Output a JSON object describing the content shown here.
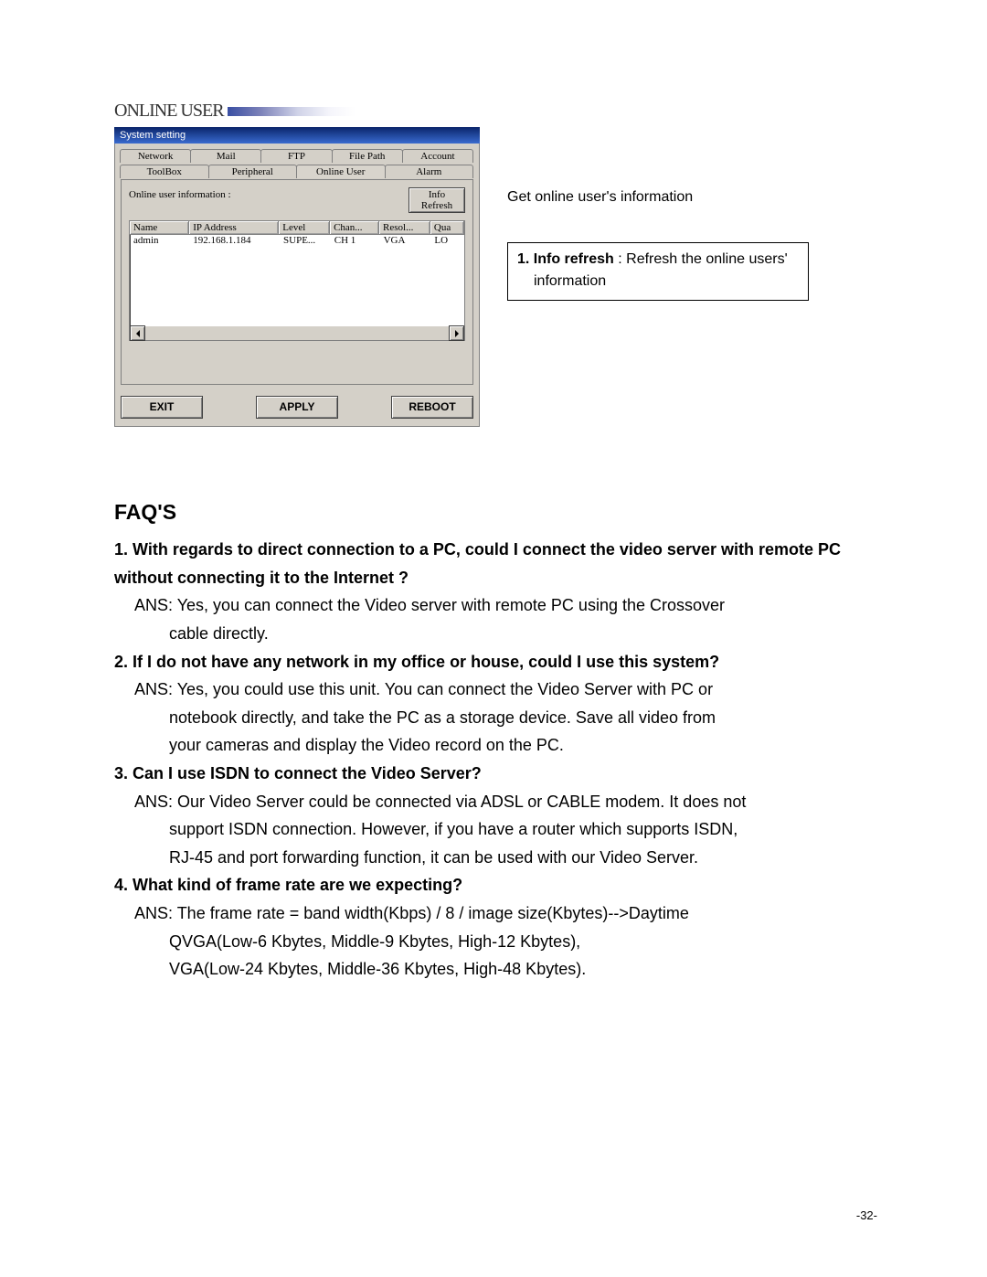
{
  "section_header": "ONLINE USER",
  "dialog": {
    "title": "System setting",
    "tabs_top": [
      "Network",
      "Mail",
      "FTP",
      "File Path",
      "Account"
    ],
    "tabs_bottom": [
      "ToolBox",
      "Peripheral",
      "Online User",
      "Alarm"
    ],
    "info_label": "Online user information :",
    "info_btn": "Info\nRefresh",
    "columns": [
      "Name",
      "IP Address",
      "Level",
      "Chan...",
      "Resol...",
      "Qua"
    ],
    "rows": [
      {
        "name": "admin",
        "ip": "192.168.1.184",
        "level": "SUPE...",
        "chan": "CH 1",
        "resol": "VGA",
        "qua": "LO"
      }
    ],
    "btn_exit": "EXIT",
    "btn_apply": "APPLY",
    "btn_reboot": "REBOOT"
  },
  "side": {
    "caption": "Get online user's information",
    "info_lead": "1. Info refresh",
    "info_sep": " : ",
    "info_rest": "Refresh the online users'",
    "info_line2": "information"
  },
  "faq": {
    "title": "FAQ'S",
    "q1": "1. With regards to direct connection to a PC, could I connect the video server with remote PC without connecting it to the Internet ?",
    "a1a": "ANS: Yes, you can connect  the Video server with remote PC using the Crossover",
    "a1b": "cable directly.",
    "q2": "2. If I do not have any network in my office or house, could I use this system?",
    "a2a": "ANS: Yes, you could use this unit. You can connect the Video Server with PC or",
    "a2b": "notebook directly, and take the PC as a storage device. Save all video from",
    "a2c": "your cameras and display the Video record on the PC.",
    "q3": "3. Can I use ISDN to connect the Video Server?",
    "a3a": "ANS: Our Video Server could be connected via ADSL or CABLE modem. It does not",
    "a3b": "support ISDN connection. However, if you have a router which supports ISDN,",
    "a3c": "RJ-45 and port forwarding function, it can be used with our Video Server.",
    "q4": "4. What kind of frame rate are we expecting?",
    "a4a": "ANS: The frame rate = band width(Kbps) / 8 / image size(Kbytes)-->Daytime",
    "a4b": "QVGA(Low-6 Kbytes, Middle-9 Kbytes, High-12 Kbytes),",
    "a4c": " VGA(Low-24 Kbytes, Middle-36 Kbytes, High-48 Kbytes)."
  },
  "page_no": "-32-"
}
